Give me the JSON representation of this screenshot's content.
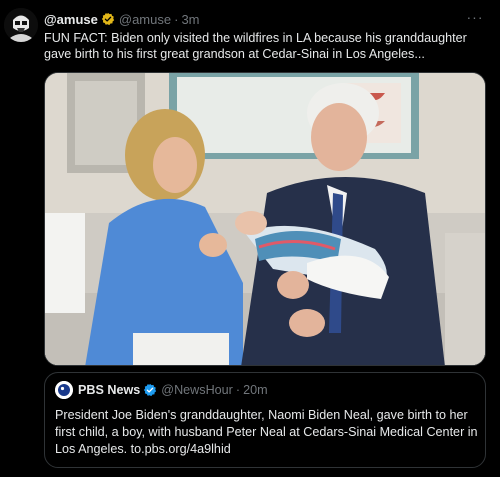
{
  "tweet": {
    "author": {
      "display_name": "@amuse",
      "handle": "@amuse",
      "time": "3m",
      "avatar_icon": "stormtrooper-avatar-icon",
      "verified_color": "#e2b719"
    },
    "text": "FUN FACT: Biden only visited the wildfires in LA because his granddaughter gave birth to his first great grandson at Cedar-Sinai in Los Angeles...",
    "more_icon": "more-options-icon",
    "media": {
      "description_icon": "photo-icon"
    }
  },
  "quote": {
    "author": {
      "display_name": "PBS News",
      "handle": "@NewsHour",
      "time": "20m",
      "avatar_icon": "pbs-logo-icon",
      "verified_color": "#1d9bf0"
    },
    "text": "President Joe Biden's granddaughter, Naomi Biden Neal, gave birth to her first child, a boy, with husband Peter Neal at Cedars-Sinai Medical Center in Los Angeles. to.pbs.org/4a9lhid"
  },
  "colors": {
    "background": "#000000",
    "text_primary": "#e7e9ea",
    "text_secondary": "#71767b",
    "border": "#2f3336"
  }
}
